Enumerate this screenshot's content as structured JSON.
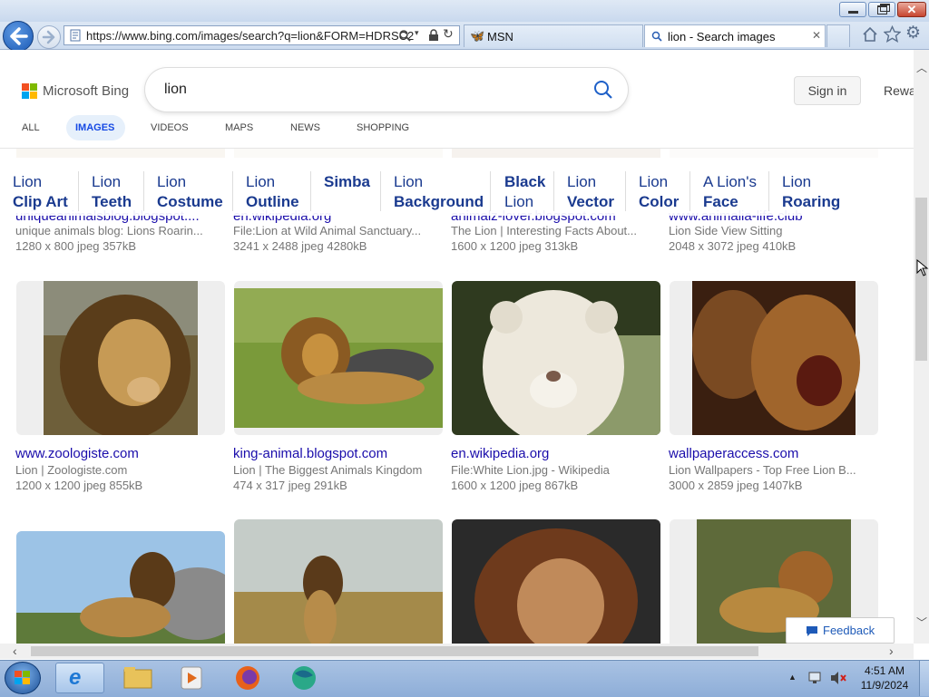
{
  "browser": {
    "url": "https://www.bing.com/images/search?q=lion&FORM=HDRSC2",
    "tabs": [
      {
        "label": "MSN",
        "icon": "msn-butterfly-icon"
      },
      {
        "label": "lion - Search images",
        "icon": "search-icon"
      }
    ]
  },
  "bing": {
    "logo_text": "Microsoft Bing",
    "query": "lion",
    "sign_in": "Sign in",
    "rewards": "Rewa",
    "nav": [
      "ALL",
      "IMAGES",
      "VIDEOS",
      "MAPS",
      "NEWS",
      "SHOPPING"
    ],
    "active_nav": "IMAGES"
  },
  "related": [
    {
      "l1": "Lion",
      "l2": "Clip Art"
    },
    {
      "l1": "Lion",
      "l2": "Teeth"
    },
    {
      "l1": "Lion",
      "l2": "Costume"
    },
    {
      "l1": "Lion",
      "l2": "Outline"
    },
    {
      "l1": "Simba",
      "l2": ""
    },
    {
      "l1": "Lion",
      "l2": "Background"
    },
    {
      "l1": "Black",
      "l2": "Lion"
    },
    {
      "l1": "Lion",
      "l2": "Vector"
    },
    {
      "l1": "Lion",
      "l2": "Color"
    },
    {
      "l1": "A Lion's",
      "l2": "Face"
    },
    {
      "l1": "Lion",
      "l2": "Roaring"
    }
  ],
  "row1": [
    {
      "domain": "uniqueanimalsblog.blogspot....",
      "title": "unique animals blog: Lions Roarin...",
      "meta": "1280 x 800 jpeg 357kB"
    },
    {
      "domain": "en.wikipedia.org",
      "title": "File:Lion at Wild Animal Sanctuary...",
      "meta": "3241 x 2488 jpeg 4280kB"
    },
    {
      "domain": "animalz-lover.blogspot.com",
      "title": "The Lion | Interesting Facts About...",
      "meta": "1600 x 1200 jpeg 313kB"
    },
    {
      "domain": "www.animalia-life.club",
      "title": "Lion Side View Sitting",
      "meta": "2048 x 3072 jpeg 410kB"
    }
  ],
  "row2": [
    {
      "domain": "www.zoologiste.com",
      "title": "Lion | Zoologiste.com",
      "meta": "1200 x 1200 jpeg 855kB"
    },
    {
      "domain": "king-animal.blogspot.com",
      "title": "Lion | The Biggest Animals Kingdom",
      "meta": "474 x 317 jpeg 291kB"
    },
    {
      "domain": "en.wikipedia.org",
      "title": "File:White Lion.jpg - Wikipedia",
      "meta": "1600 x 1200 jpeg 867kB"
    },
    {
      "domain": "wallpaperaccess.com",
      "title": "Lion Wallpapers - Top Free Lion B...",
      "meta": "3000 x 2859 jpeg 1407kB"
    }
  ],
  "feedback": "Feedback",
  "taskbar": {
    "time": "4:51 AM",
    "date": "11/9/2024"
  }
}
